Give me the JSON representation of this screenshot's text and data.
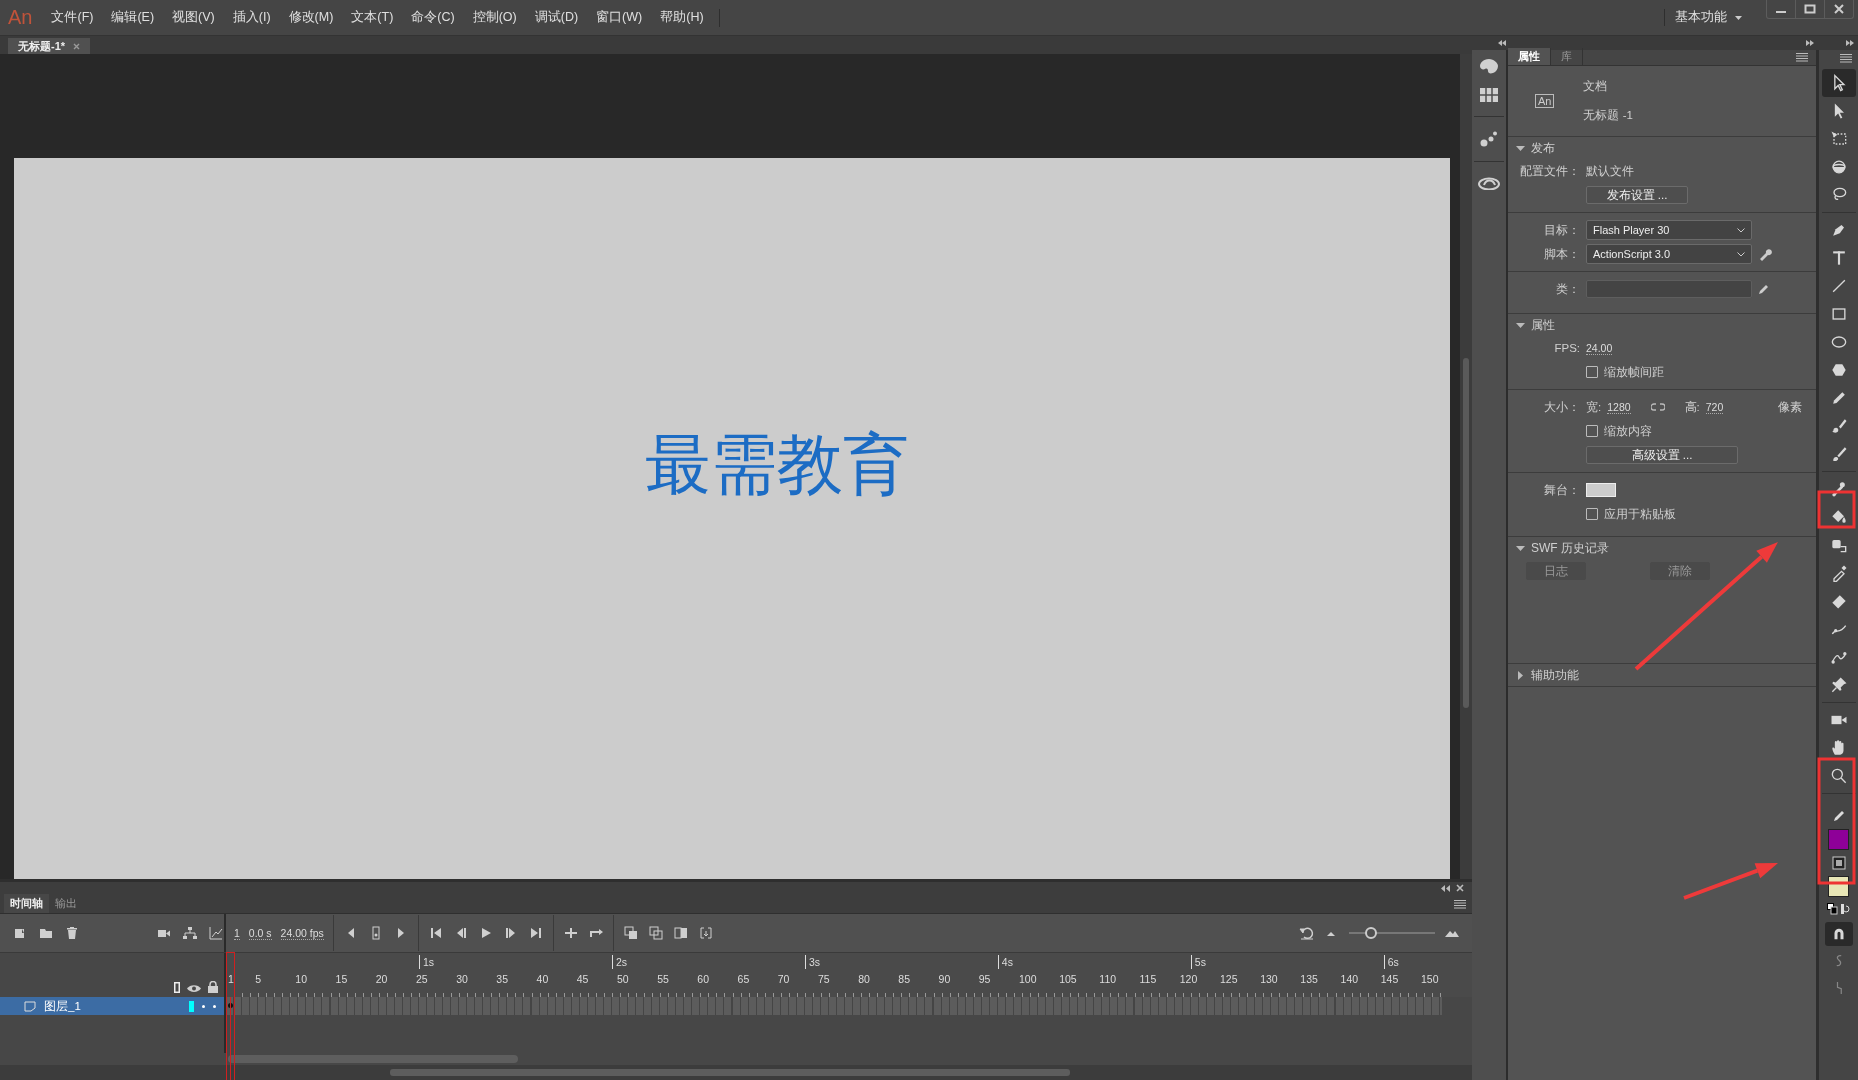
{
  "app": {
    "logo": "An"
  },
  "menu": [
    "文件(F)",
    "编辑(E)",
    "视图(V)",
    "插入(I)",
    "修改(M)",
    "文本(T)",
    "命令(C)",
    "控制(O)",
    "调试(D)",
    "窗口(W)",
    "帮助(H)"
  ],
  "workspace": "基本功能",
  "document_tabs": [
    {
      "label": "无标题-1*",
      "selected": true
    }
  ],
  "stage": {
    "text": "最需教育"
  },
  "panel_tabs": [
    {
      "label": "属性",
      "selected": true
    },
    {
      "label": "库",
      "selected": false
    }
  ],
  "document": {
    "badge": "An",
    "type": "文档",
    "name": "无标题 -1"
  },
  "publish": {
    "title": "发布",
    "expanded": true,
    "profile_label": "配置文件：",
    "profile_value": "默认文件",
    "settings_button": "发布设置 ...",
    "target_label": "目标：",
    "target_value": "Flash Player 30",
    "script_label": "脚本：",
    "script_value": "ActionScript 3.0",
    "class_label": "类："
  },
  "properties": {
    "title": "属性",
    "expanded": true,
    "fps_label": "FPS:",
    "fps_value": "24.00",
    "scale_frames": {
      "label": "缩放帧间距",
      "checked": false
    },
    "size_label": "大小：",
    "width_label": "宽:",
    "width_value": "1280",
    "height_label": "高:",
    "height_value": "720",
    "unit": "像素",
    "scale_content": {
      "label": "缩放内容",
      "checked": false
    },
    "advanced_button": "高级设置 ...",
    "stage_label": "舞台：",
    "apply_pasteboard": {
      "label": "应用于粘贴板",
      "checked": false
    }
  },
  "swf_history": {
    "title": "SWF 历史记录",
    "expanded": true,
    "buttons": [
      {
        "label": "日志",
        "disabled": true
      },
      {
        "label": "清除",
        "disabled": true
      }
    ]
  },
  "accessibility": {
    "title": "辅助功能",
    "expanded": false
  },
  "tool_groups": [
    [
      {
        "kind": "select",
        "selected": true
      },
      {
        "kind": "subselect",
        "selected": false
      },
      {
        "kind": "transform",
        "selected": false
      },
      {
        "kind": "rotate3d",
        "selected": false
      },
      {
        "kind": "lasso",
        "selected": false
      }
    ],
    [
      {
        "kind": "pen",
        "selected": false
      },
      {
        "kind": "text",
        "selected": false
      },
      {
        "kind": "line",
        "selected": false
      },
      {
        "kind": "rect",
        "selected": false
      },
      {
        "kind": "oval",
        "selected": false
      },
      {
        "kind": "polystar",
        "selected": false
      },
      {
        "kind": "pencil",
        "selected": false
      },
      {
        "kind": "paintbrush",
        "selected": false
      },
      {
        "kind": "brush",
        "selected": false
      }
    ],
    [
      {
        "kind": "bone",
        "selected": false
      },
      {
        "kind": "bucket",
        "selected": false
      },
      {
        "kind": "inkbottle",
        "selected": false
      },
      {
        "kind": "eyedropper",
        "selected": false
      },
      {
        "kind": "eraser",
        "selected": false
      },
      {
        "kind": "width",
        "selected": false
      },
      {
        "kind": "warp",
        "selected": false
      },
      {
        "kind": "pin",
        "selected": false
      }
    ],
    [
      {
        "kind": "camera",
        "selected": false
      },
      {
        "kind": "hand",
        "selected": false
      },
      {
        "kind": "zoom",
        "selected": false
      }
    ]
  ],
  "color_swatches": [
    {
      "kind": "stroke",
      "color": "#8e0098"
    },
    {
      "kind": "fill",
      "color": "#e8e6b6"
    }
  ],
  "modifiers": [
    {
      "kind": "snap",
      "on": true,
      "disabled": false
    },
    {
      "kind": "smooth",
      "on": false,
      "disabled": true
    },
    {
      "kind": "straighten",
      "on": false,
      "disabled": true
    }
  ],
  "timeline": {
    "tabs": [
      {
        "label": "时间轴",
        "selected": true
      },
      {
        "label": "输出",
        "selected": false
      }
    ],
    "current_frame": "1",
    "time": "0.0 s",
    "fps": "24.00 fps",
    "zoom_slider": {
      "level": 0.25
    },
    "seconds": [
      "1s",
      "2s",
      "3s",
      "4s",
      "5s",
      "6s"
    ],
    "frames": [
      "1",
      "5",
      "10",
      "15",
      "20",
      "25",
      "30",
      "35",
      "40",
      "45",
      "50",
      "55",
      "60",
      "65",
      "70",
      "75",
      "80",
      "85",
      "90",
      "95",
      "100",
      "105",
      "110",
      "115",
      "120",
      "125",
      "130",
      "135",
      "140",
      "145",
      "150"
    ],
    "layers": [
      {
        "name": "图层_1",
        "selected": true,
        "color": "#00ffff"
      }
    ]
  }
}
